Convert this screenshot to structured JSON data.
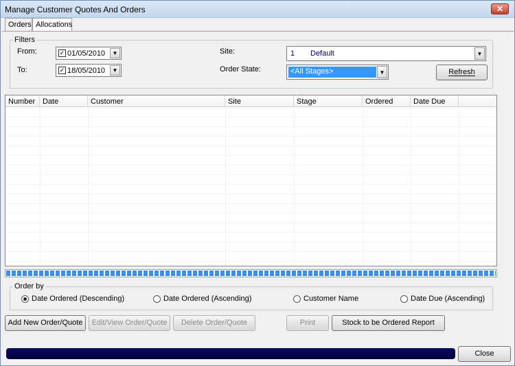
{
  "window": {
    "title": "Manage Customer Quotes And Orders",
    "close_glyph": "✕"
  },
  "tabs": [
    {
      "label": "Orders"
    },
    {
      "label": "Allocations"
    }
  ],
  "filters": {
    "group_label": "Filters",
    "from_label": "From:",
    "from_value": "01/05/2010",
    "to_label": "To:",
    "to_value": "18/05/2010",
    "site_label": "Site:",
    "site_code": "1",
    "site_name": "Default",
    "order_state_label": "Order State:",
    "order_state_value": "<All Stages>",
    "refresh_label": "Refresh"
  },
  "table": {
    "columns": [
      "Number",
      "Date",
      "Customer",
      "Site",
      "Stage",
      "Ordered",
      "Date Due"
    ],
    "rows": []
  },
  "progress": {
    "fraction": 1.0,
    "color": "#3c8ee6"
  },
  "order_by": {
    "group_label": "Order by",
    "options": [
      {
        "label": "Date Ordered (Descending)",
        "selected": true
      },
      {
        "label": "Date Ordered (Ascending)",
        "selected": false
      },
      {
        "label": "Customer Name",
        "selected": false
      },
      {
        "label": "Date Due (Ascending)",
        "selected": false
      }
    ]
  },
  "actions": {
    "add_new": "Add New Order/Quote",
    "edit_view": "Edit/View Order/Quote",
    "delete": "Delete Order/Quote",
    "print": "Print",
    "stock_report": "Stock to be Ordered Report",
    "close": "Close"
  },
  "colors": {
    "selection": "#3399ff",
    "status_bar": "#00003f"
  }
}
